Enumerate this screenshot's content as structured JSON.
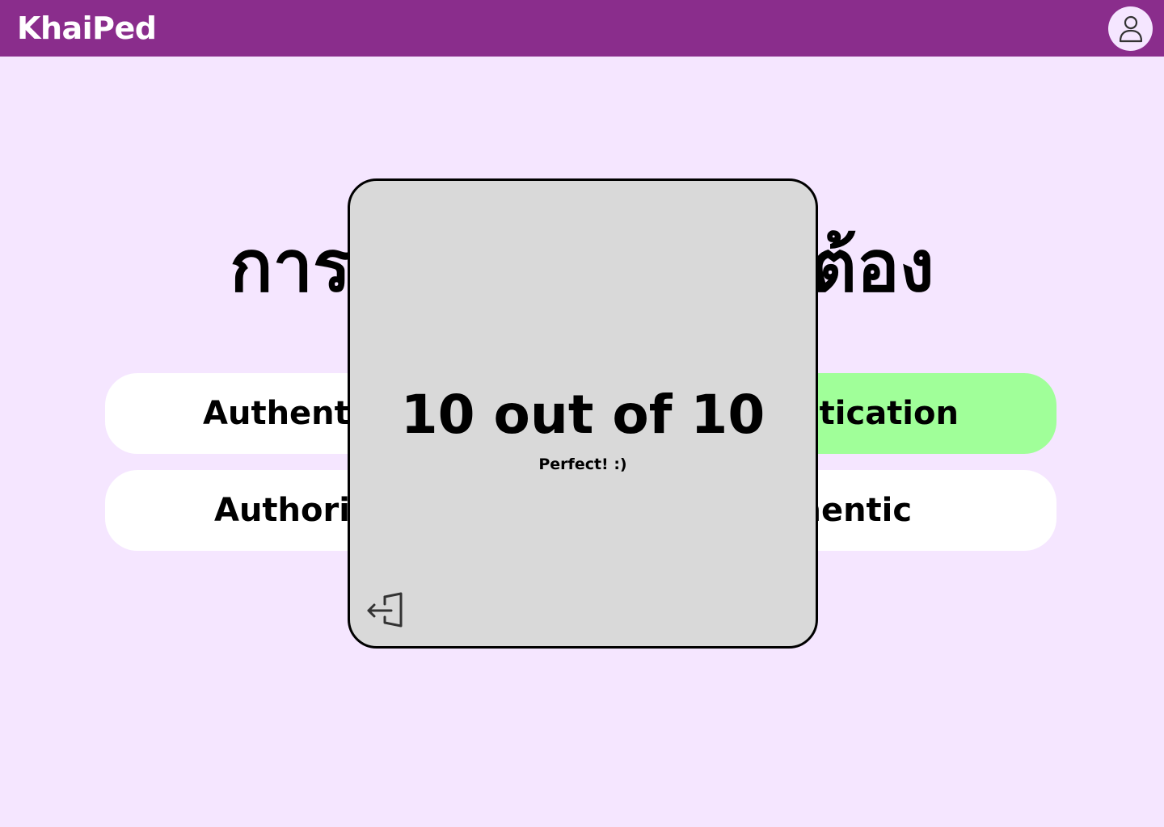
{
  "app": {
    "logo": "KhaiPed",
    "profile_icon": "user-icon"
  },
  "quiz": {
    "question": "การรับรองความถูกต้อง",
    "options": [
      {
        "label": "Authentication",
        "correct": false
      },
      {
        "label": "Authentication",
        "correct": true
      },
      {
        "label": "Authorization",
        "correct": false
      },
      {
        "label": "Authentic",
        "correct": false
      }
    ],
    "correct_color": "#a0ff99"
  },
  "result": {
    "score_text": "10 out of 10",
    "feedback": "Perfect! :)",
    "exit_icon": "exit-icon"
  },
  "colors": {
    "header": "#8a2d8c",
    "background": "#f5e6ff",
    "modal": "#d9d9d9"
  }
}
